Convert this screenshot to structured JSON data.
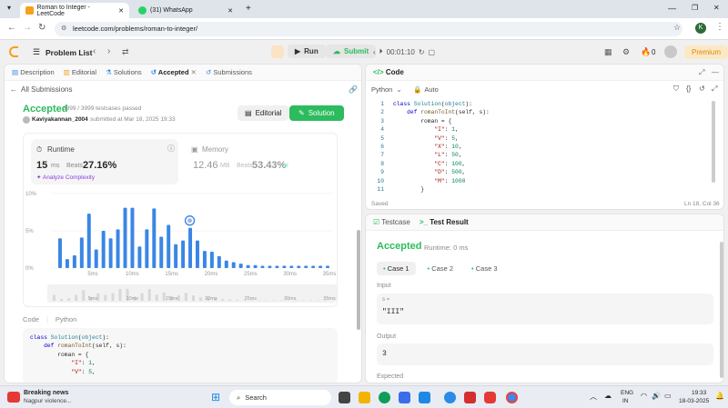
{
  "browser": {
    "tabs": [
      {
        "title": "Roman to Integer - LeetCode",
        "active": true
      },
      {
        "title": "(31) WhatsApp",
        "active": false
      }
    ],
    "url": "leetcode.com/problems/roman-to-integer/",
    "profile_initial": "K"
  },
  "lc_header": {
    "problem_list": "Problem List",
    "run_label": "Run",
    "submit_label": "Submit",
    "timer": "00:01:10",
    "streak": "0",
    "premium_label": "Premium"
  },
  "left_tabs": [
    "Description",
    "Editorial",
    "Solutions",
    "Accepted",
    "Submissions"
  ],
  "submission": {
    "back_label": "All Submissions",
    "status": "Accepted",
    "testcases": "3999 / 3999 testcases passed",
    "user": "Kaviyakannan_2004",
    "submitted_at": "submitted at Mar 18, 2025 19:33",
    "editorial_btn": "Editorial",
    "solution_btn": "Solution",
    "runtime": {
      "label": "Runtime",
      "value": "15",
      "unit": "ms",
      "beats_label": "Beats",
      "beats": "27.16%",
      "analyze": "Analyze Complexity"
    },
    "memory": {
      "label": "Memory",
      "value": "12.46",
      "unit": "MB",
      "beats_label": "Beats",
      "beats": "53.43%"
    },
    "code_label": "Code",
    "lang": "Python",
    "code_preview": [
      "class Solution(object):",
      "    def romanToInt(self, s):",
      "        roman = {",
      "            \"I\": 1,",
      "            \"V\": 5,"
    ]
  },
  "chart_data": {
    "type": "bar",
    "ylim": [
      0,
      10
    ],
    "yticks": [
      "10%",
      "5%",
      "0%"
    ],
    "xticks": [
      "5ms",
      "10ms",
      "15ms",
      "20ms",
      "25ms",
      "30ms",
      "35ms"
    ],
    "mini_xticks": [
      "5ms",
      "10ms",
      "15ms",
      "20ms",
      "25ms",
      "30ms",
      "35ms"
    ],
    "values": [
      4.0,
      1.2,
      1.7,
      4.1,
      7.3,
      2.5,
      5.0,
      4.0,
      5.2,
      8.1,
      8.1,
      2.9,
      5.2,
      8.0,
      4.2,
      5.8,
      3.2,
      3.7,
      5.4,
      3.7,
      2.3,
      2.2,
      1.6,
      1.0,
      0.8,
      0.6,
      0.4,
      0.4,
      0.3,
      0.3,
      0.3,
      0.3,
      0.3,
      0.3,
      0.3,
      0.3,
      0.3,
      0.3
    ],
    "user_bar_index": 18,
    "bar_color": "#3a86e6"
  },
  "editor": {
    "title": "Code",
    "lang": "Python",
    "mode": "Auto",
    "lines": [
      "class Solution(object):",
      "    def romanToInt(self, s):",
      "        roman = {",
      "            \"I\": 1,",
      "            \"V\": 5,",
      "            \"X\": 10,",
      "            \"L\": 50,",
      "            \"C\": 100,",
      "            \"D\": 500,",
      "            \"M\": 1000",
      "        }"
    ],
    "saved": "Saved",
    "cursor": "Ln 18, Col 36"
  },
  "result": {
    "testcase_tab": "Testcase",
    "result_tab": "Test Result",
    "status": "Accepted",
    "runtime": "Runtime: 0 ms",
    "cases": [
      "Case 1",
      "Case 2",
      "Case 3"
    ],
    "input_label": "Input",
    "input_var": "s =",
    "input_value": "\"III\"",
    "output_label": "Output",
    "output_value": "3",
    "expected_label": "Expected"
  },
  "taskbar": {
    "news_title": "Breaking news",
    "news_sub": "Nagpur violence...",
    "search": "Search",
    "lang1": "ENG",
    "lang2": "IN",
    "time": "19:33",
    "date": "18-03-2025"
  }
}
